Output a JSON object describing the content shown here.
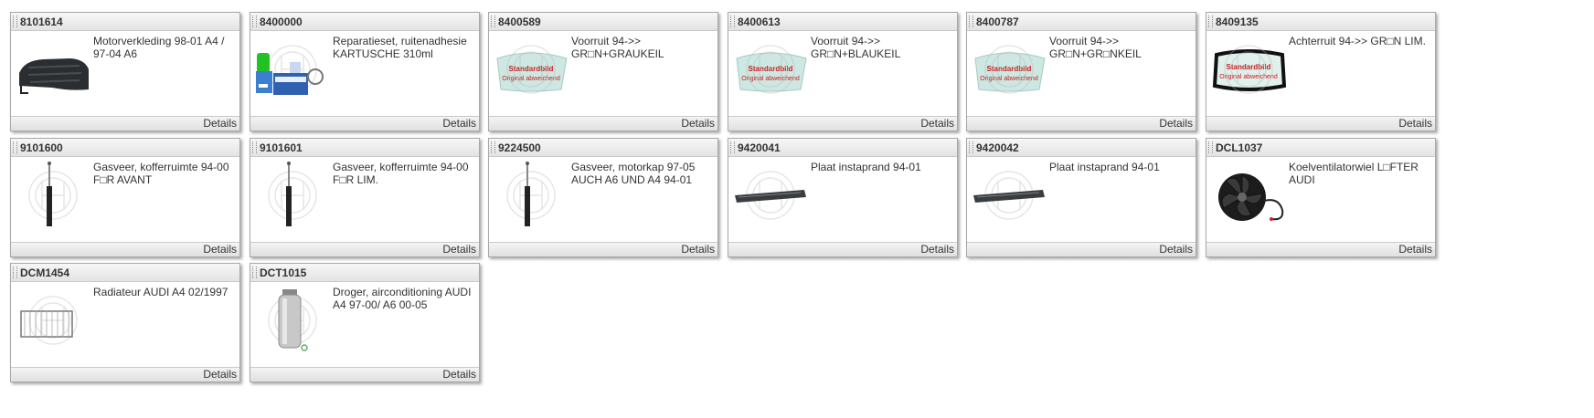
{
  "cards": [
    {
      "code": "8101614",
      "description": "Motorverkleding 98-01 A4 /\n97-04 A6",
      "details": "Details",
      "image": "engine-cover"
    },
    {
      "code": "8400000",
      "description": "Reparatieset, ruitenadhesie\nKARTUSCHE 310ml",
      "details": "Details",
      "image": "repair-kit"
    },
    {
      "code": "8400589",
      "description": "Voorruit 94->>\nGR□N+GRAUKEIL",
      "details": "Details",
      "image": "windshield-placeholder",
      "placeholder_line1": "Standardbild",
      "placeholder_line2": "Original abweichend"
    },
    {
      "code": "8400613",
      "description": "Voorruit 94->>\nGR□N+BLAUKEIL",
      "details": "Details",
      "image": "windshield-placeholder",
      "placeholder_line1": "Standardbild",
      "placeholder_line2": "Original abweichend"
    },
    {
      "code": "8400787",
      "description": "Voorruit 94->>\nGR□N+GR□NKEIL",
      "details": "Details",
      "image": "windshield-placeholder",
      "placeholder_line1": "Standardbild",
      "placeholder_line2": "Original abweichend"
    },
    {
      "code": "8409135",
      "description": "Achterruit 94->> GR□N LIM.",
      "details": "Details",
      "image": "rear-window-placeholder",
      "placeholder_line1": "Standardbild",
      "placeholder_line2": "Original abweichend"
    },
    {
      "code": "9101600",
      "description": "Gasveer, kofferruimte 94-00\nF□R AVANT",
      "details": "Details",
      "image": "gas-spring"
    },
    {
      "code": "9101601",
      "description": "Gasveer, kofferruimte 94-00\nF□R LIM.",
      "details": "Details",
      "image": "gas-spring"
    },
    {
      "code": "9224500",
      "description": "Gasveer, motorkap 97-05\nAUCH A6 UND A4 94-01",
      "details": "Details",
      "image": "gas-spring"
    },
    {
      "code": "9420041",
      "description": "Plaat instaprand 94-01",
      "details": "Details",
      "image": "sill-plate"
    },
    {
      "code": "9420042",
      "description": "Plaat instaprand 94-01",
      "details": "Details",
      "image": "sill-plate"
    },
    {
      "code": "DCL1037",
      "description": "Koelventilatorwiel L□FTER\nAUDI",
      "details": "Details",
      "image": "cooling-fan"
    },
    {
      "code": "DCM1454",
      "description": "Radiateur AUDI A4 02/1997",
      "details": "Details",
      "image": "radiator"
    },
    {
      "code": "DCT1015",
      "description": "Droger, airconditioning AUDI\nA4 97-00/ A6 00-05",
      "details": "Details",
      "image": "ac-dryer"
    }
  ]
}
